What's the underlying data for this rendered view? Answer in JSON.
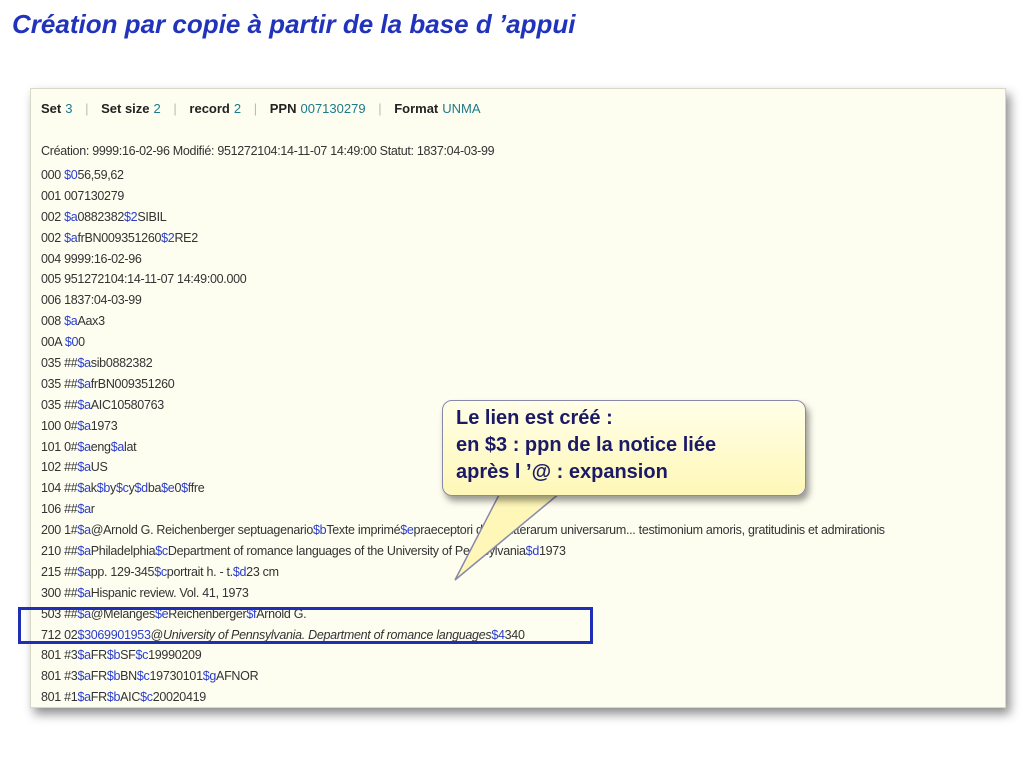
{
  "slide": {
    "title": "Création par copie à partir de la base d ’appui"
  },
  "header": {
    "set_label": "Set",
    "set_value": "3",
    "setsize_label": "Set size",
    "setsize_value": "2",
    "record_label": "record",
    "record_value": "2",
    "ppn_label": "PPN",
    "ppn_value": "007130279",
    "format_label": "Format",
    "format_value": "UNMA"
  },
  "info_line": "Création: 9999:16-02-96 Modifié: 951272104:14-11-07 14:49:00 Statut: 1837:04-03-99",
  "records": [
    [
      {
        "t": "000 "
      },
      {
        "t": "$0",
        "s": 1
      },
      {
        "t": "56,59,62"
      }
    ],
    [
      {
        "t": "001 007130279"
      }
    ],
    [
      {
        "t": "002 "
      },
      {
        "t": "$a",
        "s": 1
      },
      {
        "t": "0882382"
      },
      {
        "t": "$2",
        "s": 1
      },
      {
        "t": "SIBIL"
      }
    ],
    [
      {
        "t": "002 "
      },
      {
        "t": "$a",
        "s": 1
      },
      {
        "t": "frBN009351260"
      },
      {
        "t": "$2",
        "s": 1
      },
      {
        "t": "RE2"
      }
    ],
    [
      {
        "t": "004 9999:16-02-96"
      }
    ],
    [
      {
        "t": "005 951272104:14-11-07 14:49:00.000"
      }
    ],
    [
      {
        "t": "006 1837:04-03-99"
      }
    ],
    [
      {
        "t": "008 "
      },
      {
        "t": "$a",
        "s": 1
      },
      {
        "t": "Aax3"
      }
    ],
    [
      {
        "t": "00A "
      },
      {
        "t": "$0",
        "s": 1
      },
      {
        "t": "0"
      }
    ],
    [
      {
        "t": "035 ##"
      },
      {
        "t": "$a",
        "s": 1
      },
      {
        "t": "sib0882382"
      }
    ],
    [
      {
        "t": "035 ##"
      },
      {
        "t": "$a",
        "s": 1
      },
      {
        "t": "frBN009351260"
      }
    ],
    [
      {
        "t": "035 ##"
      },
      {
        "t": "$a",
        "s": 1
      },
      {
        "t": "AIC10580763"
      }
    ],
    [
      {
        "t": "100 0#"
      },
      {
        "t": "$a",
        "s": 1
      },
      {
        "t": "1973"
      }
    ],
    [
      {
        "t": "101 0#"
      },
      {
        "t": "$a",
        "s": 1
      },
      {
        "t": "eng"
      },
      {
        "t": "$a",
        "s": 1
      },
      {
        "t": "lat"
      }
    ],
    [
      {
        "t": "102 ##"
      },
      {
        "t": "$a",
        "s": 1
      },
      {
        "t": "US"
      }
    ],
    [
      {
        "t": "104 ##"
      },
      {
        "t": "$a",
        "s": 1
      },
      {
        "t": "k"
      },
      {
        "t": "$b",
        "s": 1
      },
      {
        "t": "y"
      },
      {
        "t": "$c",
        "s": 1
      },
      {
        "t": "y"
      },
      {
        "t": "$d",
        "s": 1
      },
      {
        "t": "ba"
      },
      {
        "t": "$e",
        "s": 1
      },
      {
        "t": "0"
      },
      {
        "t": "$f",
        "s": 1
      },
      {
        "t": "fre"
      }
    ],
    [
      {
        "t": "106 ##"
      },
      {
        "t": "$a",
        "s": 1
      },
      {
        "t": "r"
      }
    ],
    [
      {
        "t": "200 1#"
      },
      {
        "t": "$a",
        "s": 1
      },
      {
        "t": "@Arnold G. Reichenberger septuagenario"
      },
      {
        "t": "$b",
        "s": 1
      },
      {
        "t": "Texte imprimé"
      },
      {
        "t": "$e",
        "s": 1
      },
      {
        "t": "praeceptori docto litterarum universarum... testimonium amoris, gratitudinis et admirationis"
      }
    ],
    [
      {
        "t": "210 ##"
      },
      {
        "t": "$a",
        "s": 1
      },
      {
        "t": "Philadelphia"
      },
      {
        "t": "$c",
        "s": 1
      },
      {
        "t": "Department of romance languages of the University of Pennsylvania"
      },
      {
        "t": "$d",
        "s": 1
      },
      {
        "t": "1973"
      }
    ],
    [
      {
        "t": "215 ##"
      },
      {
        "t": "$a",
        "s": 1
      },
      {
        "t": "pp. 129-345"
      },
      {
        "t": "$c",
        "s": 1
      },
      {
        "t": "portrait h. - t."
      },
      {
        "t": "$d",
        "s": 1
      },
      {
        "t": "23 cm"
      }
    ],
    [
      {
        "t": "300 ##"
      },
      {
        "t": "$a",
        "s": 1
      },
      {
        "t": "Hispanic review. Vol. 41, 1973"
      }
    ],
    [
      {
        "t": "503 ##"
      },
      {
        "t": "$a",
        "s": 1
      },
      {
        "t": "@Mélanges"
      },
      {
        "t": "$e",
        "s": 1
      },
      {
        "t": "Reichenberger"
      },
      {
        "t": "$f",
        "s": 1
      },
      {
        "t": "Arnold G."
      }
    ],
    [
      {
        "t": "712 02"
      },
      {
        "t": "$3069901953",
        "s": 1
      },
      {
        "t": "@"
      },
      {
        "t": "University of Pennsylvania. Department of romance languages",
        "i": 1
      },
      {
        "t": "$4",
        "s": 1
      },
      {
        "t": "340"
      }
    ],
    [
      {
        "t": "801 #3"
      },
      {
        "t": "$a",
        "s": 1
      },
      {
        "t": "FR"
      },
      {
        "t": "$b",
        "s": 1
      },
      {
        "t": "SF"
      },
      {
        "t": "$c",
        "s": 1
      },
      {
        "t": "19990209"
      }
    ],
    [
      {
        "t": "801 #3"
      },
      {
        "t": "$a",
        "s": 1
      },
      {
        "t": "FR"
      },
      {
        "t": "$b",
        "s": 1
      },
      {
        "t": "BN"
      },
      {
        "t": "$c",
        "s": 1
      },
      {
        "t": "19730101"
      },
      {
        "t": "$g",
        "s": 1
      },
      {
        "t": "AFNOR"
      }
    ],
    [
      {
        "t": "801 #1"
      },
      {
        "t": "$a",
        "s": 1
      },
      {
        "t": "FR"
      },
      {
        "t": "$b",
        "s": 1
      },
      {
        "t": "AIC"
      },
      {
        "t": "$c",
        "s": 1
      },
      {
        "t": "20020419"
      }
    ]
  ],
  "callout": {
    "line1": "Le  lien est créé :",
    "line2": "en $3 : ppn de la notice liée",
    "line3": "après l ’@ : expansion"
  },
  "colors": {
    "title": "#2233bb",
    "subfield": "#2a3ecc",
    "header_value": "#1d7a8a",
    "highlight_border": "#1f2fb5",
    "callout_fill": "#fff7b8"
  }
}
